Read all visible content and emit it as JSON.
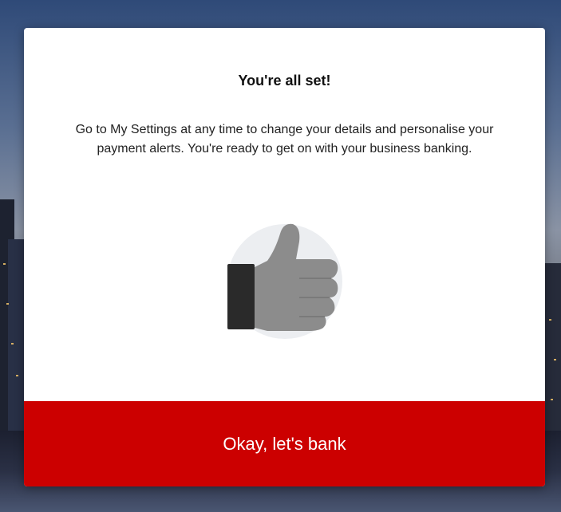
{
  "dialog": {
    "title": "You're all set!",
    "message": "Go to My Settings at any time to change your details and personalise your payment alerts. You're ready to get on with your business banking.",
    "illustration_icon": "thumbs-up-icon",
    "primary_button_label": "Okay, let's bank"
  },
  "colors": {
    "accent": "#cc0000",
    "dialog_background": "#ffffff",
    "title_text": "#111111",
    "body_text": "#222222",
    "illustration_circle": "#eceef1",
    "thumb": "#8c8c8c",
    "cuff": "#2a2a2a"
  }
}
